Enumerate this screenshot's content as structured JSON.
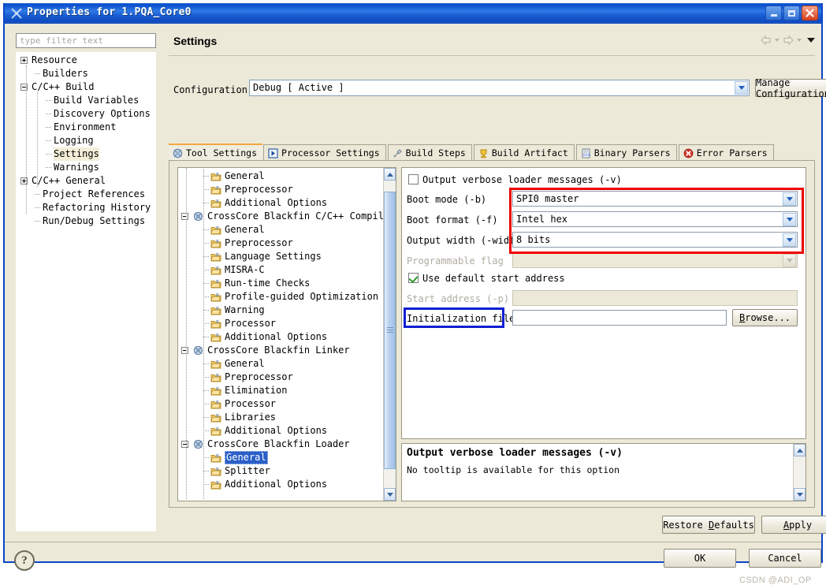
{
  "window": {
    "title": "Properties for 1.PQA_Core0",
    "icon": "properties-icon",
    "minimize_label": "Minimize",
    "maximize_label": "Maximize",
    "close_label": "×"
  },
  "filter": {
    "placeholder": "type filter text",
    "value": ""
  },
  "sidebar": {
    "items": [
      {
        "label": "Resource",
        "depth": 0,
        "toggle": "plus",
        "selected": false
      },
      {
        "label": "Builders",
        "depth": 1,
        "toggle": "none",
        "selected": false
      },
      {
        "label": "C/C++ Build",
        "depth": 0,
        "toggle": "minus",
        "selected": false
      },
      {
        "label": "Build Variables",
        "depth": 2,
        "toggle": "none",
        "selected": false
      },
      {
        "label": "Discovery Options",
        "depth": 2,
        "toggle": "none",
        "selected": false
      },
      {
        "label": "Environment",
        "depth": 2,
        "toggle": "none",
        "selected": false
      },
      {
        "label": "Logging",
        "depth": 2,
        "toggle": "none",
        "selected": false
      },
      {
        "label": "Settings",
        "depth": 2,
        "toggle": "none",
        "selected": true
      },
      {
        "label": "Warnings",
        "depth": 2,
        "toggle": "none",
        "selected": false
      },
      {
        "label": "C/C++ General",
        "depth": 0,
        "toggle": "plus",
        "selected": false
      },
      {
        "label": "Project References",
        "depth": 1,
        "toggle": "none",
        "selected": false
      },
      {
        "label": "Refactoring History",
        "depth": 1,
        "toggle": "none",
        "selected": false
      },
      {
        "label": "Run/Debug Settings",
        "depth": 1,
        "toggle": "none",
        "selected": false
      }
    ]
  },
  "header": {
    "title": "Settings",
    "back_icon": "back-arrow-icon",
    "forward_icon": "forward-arrow-icon",
    "menu_icon": "view-menu-icon"
  },
  "configuration": {
    "label": "Configuration:",
    "value": "Debug  [ Active ]",
    "manage_button": "Manage Configurations..."
  },
  "tabs": [
    {
      "label": "Tool Settings",
      "icon": "tool-settings-icon",
      "active": true
    },
    {
      "label": "Processor Settings",
      "icon": "processor-settings-icon",
      "active": false
    },
    {
      "label": "Build Steps",
      "icon": "build-steps-icon",
      "active": false
    },
    {
      "label": "Build Artifact",
      "icon": "build-artifact-icon",
      "active": false
    },
    {
      "label": "Binary Parsers",
      "icon": "binary-parsers-icon",
      "active": false
    },
    {
      "label": "Error Parsers",
      "icon": "error-parsers-icon",
      "active": false
    }
  ],
  "tool_tree": {
    "items": [
      {
        "label": "General",
        "depth": 1,
        "kind": "folder",
        "toggle": "none",
        "selected": false
      },
      {
        "label": "Preprocessor",
        "depth": 1,
        "kind": "folder",
        "toggle": "none",
        "selected": false
      },
      {
        "label": "Additional Options",
        "depth": 1,
        "kind": "folder",
        "toggle": "none",
        "selected": false
      },
      {
        "label": "CrossCore Blackfin C/C++ Compiler",
        "depth": 0,
        "kind": "gear",
        "toggle": "minus",
        "selected": false
      },
      {
        "label": "General",
        "depth": 1,
        "kind": "folder",
        "toggle": "none",
        "selected": false
      },
      {
        "label": "Preprocessor",
        "depth": 1,
        "kind": "folder",
        "toggle": "none",
        "selected": false
      },
      {
        "label": "Language Settings",
        "depth": 1,
        "kind": "folder",
        "toggle": "none",
        "selected": false
      },
      {
        "label": "MISRA-C",
        "depth": 1,
        "kind": "folder",
        "toggle": "none",
        "selected": false
      },
      {
        "label": "Run-time Checks",
        "depth": 1,
        "kind": "folder",
        "toggle": "none",
        "selected": false
      },
      {
        "label": "Profile-guided Optimization",
        "depth": 1,
        "kind": "folder",
        "toggle": "none",
        "selected": false
      },
      {
        "label": "Warning",
        "depth": 1,
        "kind": "folder",
        "toggle": "none",
        "selected": false
      },
      {
        "label": "Processor",
        "depth": 1,
        "kind": "folder",
        "toggle": "none",
        "selected": false
      },
      {
        "label": "Additional Options",
        "depth": 1,
        "kind": "folder",
        "toggle": "none",
        "selected": false
      },
      {
        "label": "CrossCore Blackfin Linker",
        "depth": 0,
        "kind": "gear",
        "toggle": "minus",
        "selected": false
      },
      {
        "label": "General",
        "depth": 1,
        "kind": "folder",
        "toggle": "none",
        "selected": false
      },
      {
        "label": "Preprocessor",
        "depth": 1,
        "kind": "folder",
        "toggle": "none",
        "selected": false
      },
      {
        "label": "Elimination",
        "depth": 1,
        "kind": "folder",
        "toggle": "none",
        "selected": false
      },
      {
        "label": "Processor",
        "depth": 1,
        "kind": "folder",
        "toggle": "none",
        "selected": false
      },
      {
        "label": "Libraries",
        "depth": 1,
        "kind": "folder",
        "toggle": "none",
        "selected": false
      },
      {
        "label": "Additional Options",
        "depth": 1,
        "kind": "folder",
        "toggle": "none",
        "selected": false
      },
      {
        "label": "CrossCore Blackfin Loader",
        "depth": 0,
        "kind": "gear",
        "toggle": "minus",
        "selected": false
      },
      {
        "label": "General",
        "depth": 1,
        "kind": "folder",
        "toggle": "none",
        "selected": true
      },
      {
        "label": "Splitter",
        "depth": 1,
        "kind": "folder",
        "toggle": "none",
        "selected": false
      },
      {
        "label": "Additional Options",
        "depth": 1,
        "kind": "folder",
        "toggle": "none",
        "selected": false
      }
    ]
  },
  "options": {
    "verbose": {
      "label": "Output verbose loader messages (-v)",
      "checked": false
    },
    "boot_mode": {
      "label": "Boot mode (-b)",
      "value": "SPI0 master"
    },
    "boot_format": {
      "label": "Boot format (-f)",
      "value": "Intel hex"
    },
    "output_width": {
      "label": "Output width (-width)",
      "value": "8 bits"
    },
    "prog_flag": {
      "label": "Programmable flag",
      "value": "",
      "disabled": true
    },
    "use_default": {
      "label": "Use default start address",
      "checked": true
    },
    "start_addr": {
      "label": "Start address (-p)",
      "value": "",
      "disabled": true
    },
    "init_file": {
      "label": "Initialization file",
      "value": "",
      "browse": "Browse..."
    }
  },
  "highlights": {
    "red_color": "#ee0000",
    "blue_color": "#0d1fd2"
  },
  "tooltip": {
    "title": "Output verbose loader messages (-v)",
    "body": "No tooltip is available for this option",
    "scroll_up_icon": "scroll-up-icon",
    "scroll_down_icon": "scroll-down-icon"
  },
  "footer": {
    "restore_defaults": "Restore Defaults",
    "restore_defaults_mnemonic": "D",
    "apply": "Apply",
    "apply_mnemonic": "A",
    "ok": "OK",
    "cancel": "Cancel",
    "help_icon": "help-question-icon"
  },
  "watermark": "CSDN @ADI_OP"
}
